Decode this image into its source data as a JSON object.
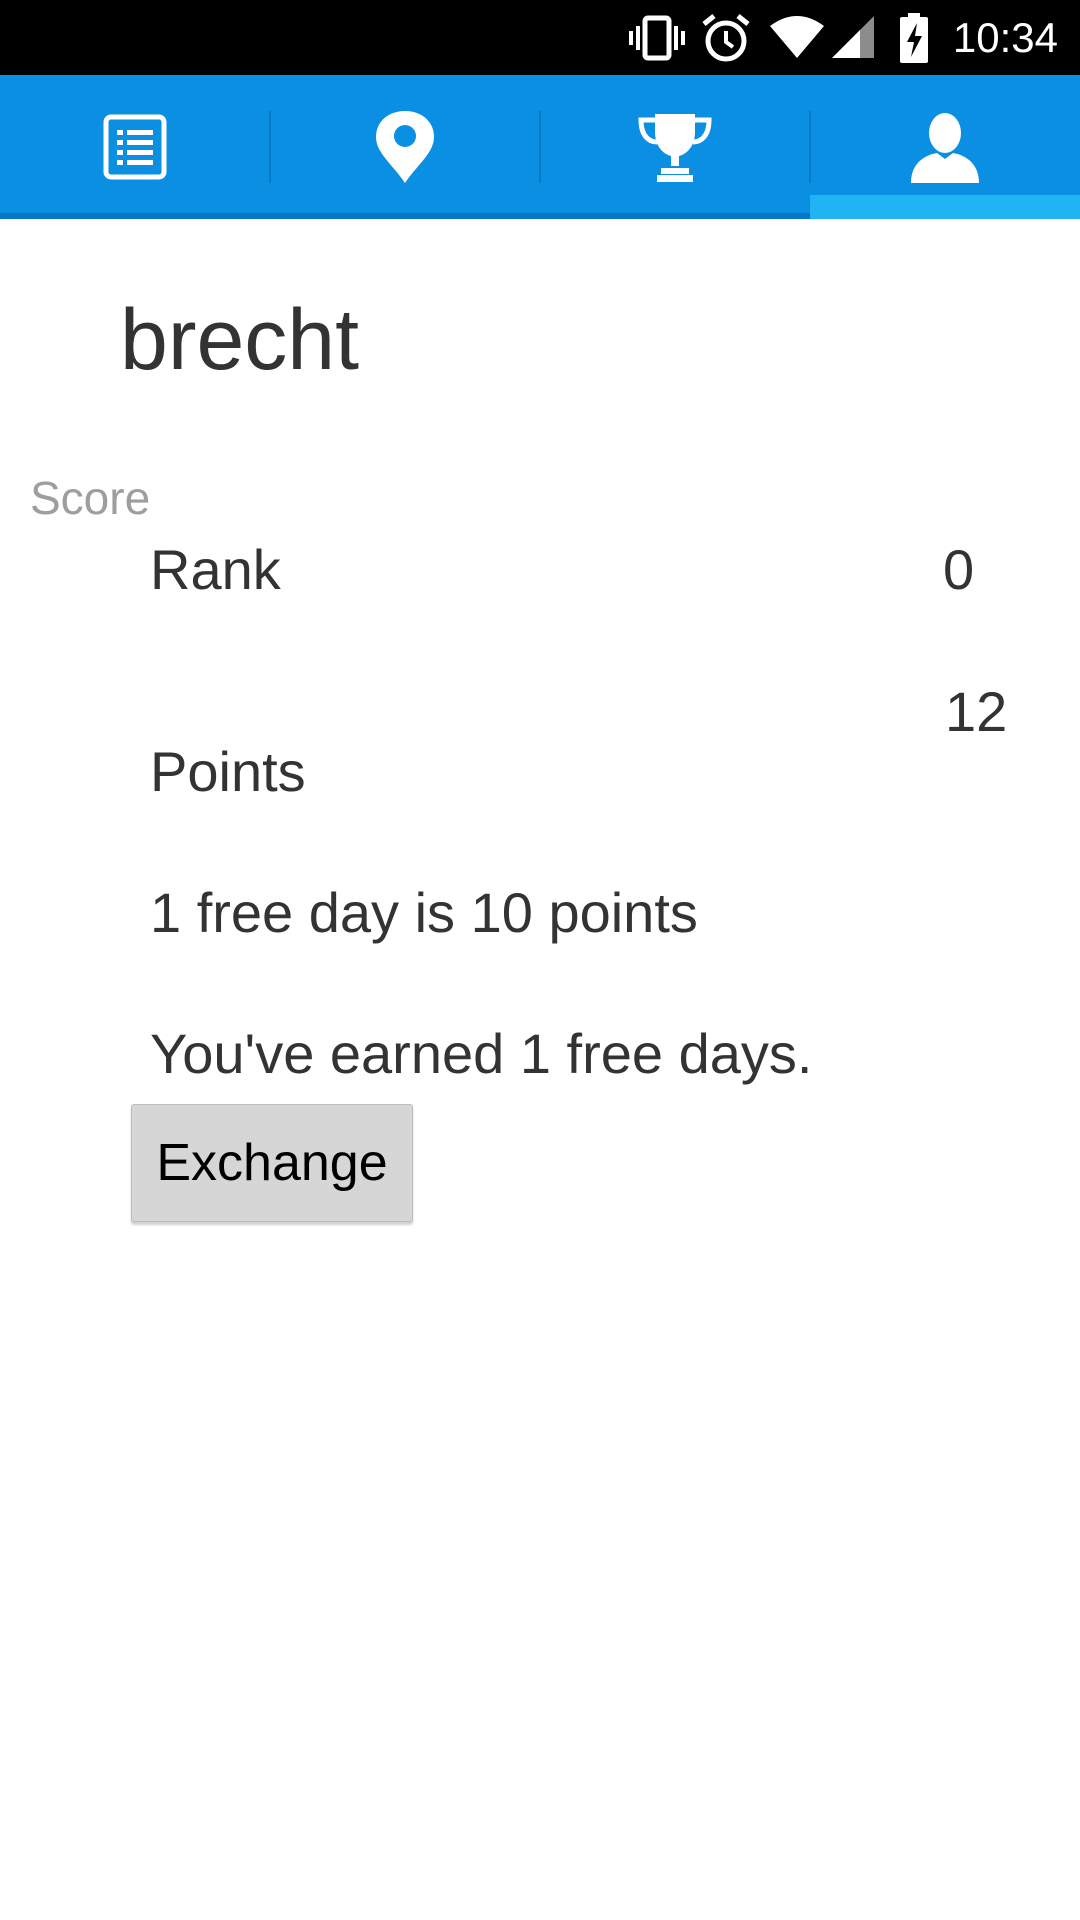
{
  "status_bar": {
    "time": "10:34",
    "icons": [
      "vibrate-icon",
      "alarm-icon",
      "wifi-icon",
      "cell-signal-icon",
      "battery-charging-icon"
    ]
  },
  "tabs": [
    {
      "name": "list",
      "icon": "list-icon",
      "selected": false
    },
    {
      "name": "location",
      "icon": "location-pin-icon",
      "selected": false
    },
    {
      "name": "trophy",
      "icon": "trophy-icon",
      "selected": false
    },
    {
      "name": "profile",
      "icon": "user-icon",
      "selected": true
    }
  ],
  "colors": {
    "tab_bar": "#0a8fe3",
    "tab_indicator": "#20b4f5",
    "text": "#333333",
    "label_gray": "#9e9e9e"
  },
  "profile": {
    "username": "brecht",
    "section_label": "Score",
    "rank_label": "Rank",
    "rank_value": "0",
    "points_label": "Points",
    "points_value": "12",
    "free_day_info": "1 free day is 10 points",
    "earned_info": "You've earned 1 free days.",
    "exchange_button": "Exchange"
  }
}
